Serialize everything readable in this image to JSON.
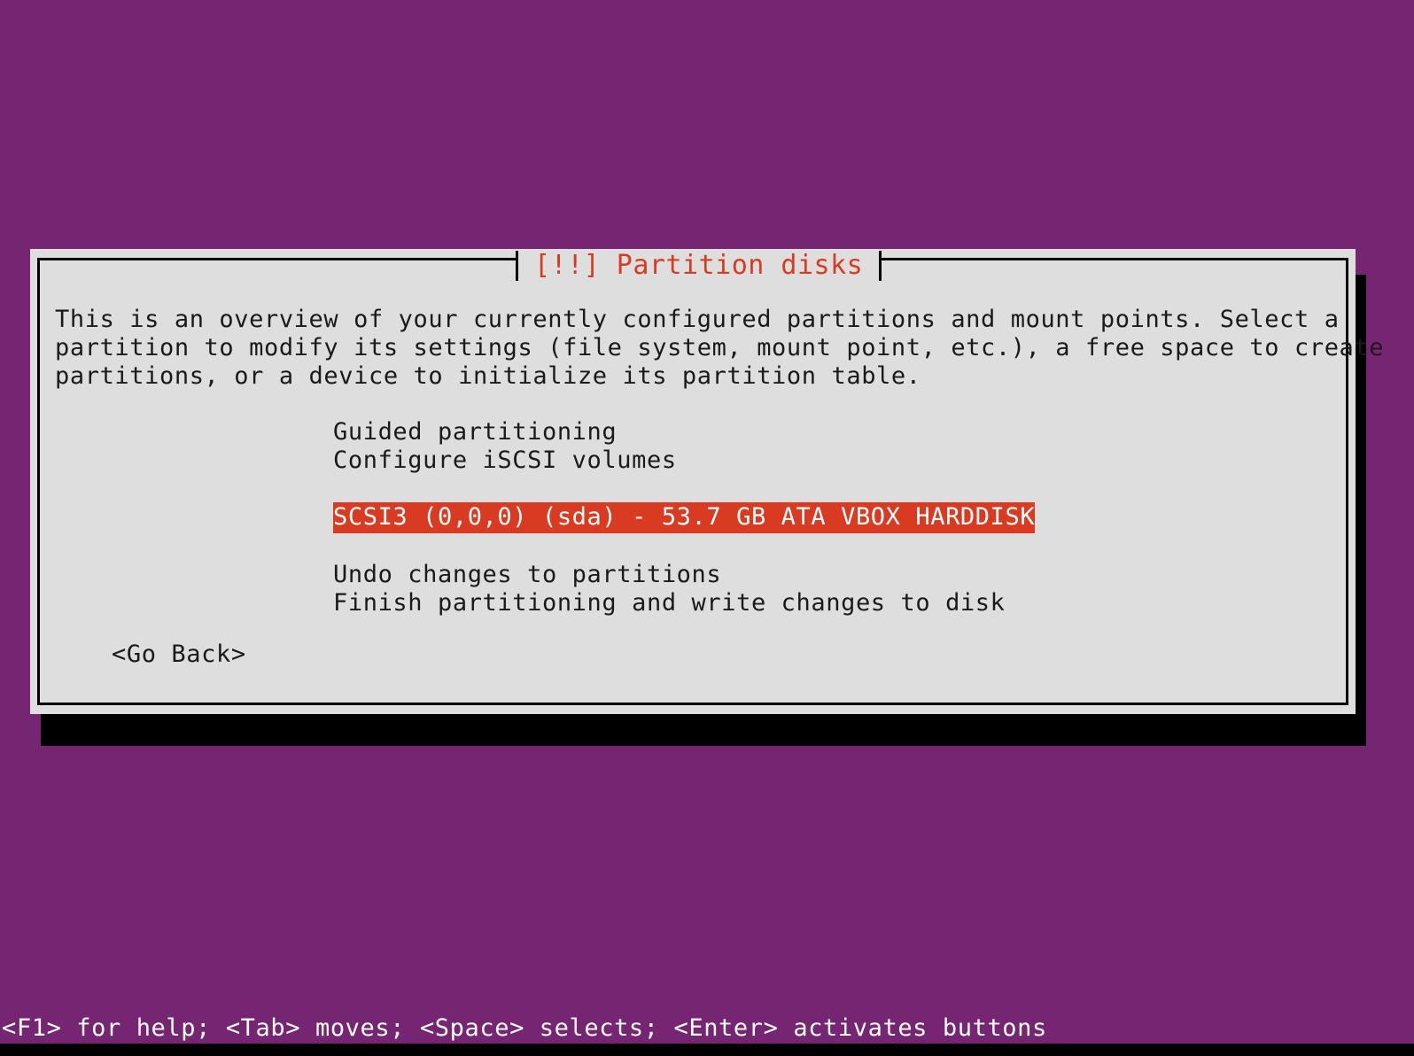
{
  "screen": {
    "background_color": "#762572",
    "dialog_background_color": "#dedede",
    "accent_color": "#d93a22",
    "text_color": "#1a1a1a"
  },
  "dialog": {
    "title": "[!!] Partition disks",
    "description_lines": [
      "This is an overview of your currently configured partitions and mount points. Select a",
      "partition to modify its settings (file system, mount point, etc.), a free space to create",
      "partitions, or a device to initialize its partition table."
    ],
    "menu_items": [
      {
        "label": "Guided partitioning",
        "selected": false,
        "spacer_before": false
      },
      {
        "label": "Configure iSCSI volumes",
        "selected": false,
        "spacer_before": false
      },
      {
        "label": "SCSI3 (0,0,0) (sda) - 53.7 GB ATA VBOX HARDDISK",
        "selected": true,
        "spacer_before": true
      },
      {
        "label": "Undo changes to partitions",
        "selected": false,
        "spacer_before": true
      },
      {
        "label": "Finish partitioning and write changes to disk",
        "selected": false,
        "spacer_before": false
      }
    ],
    "go_back_label": "<Go Back>"
  },
  "status_bar": {
    "text": "<F1> for help; <Tab> moves; <Space> selects; <Enter> activates buttons"
  }
}
